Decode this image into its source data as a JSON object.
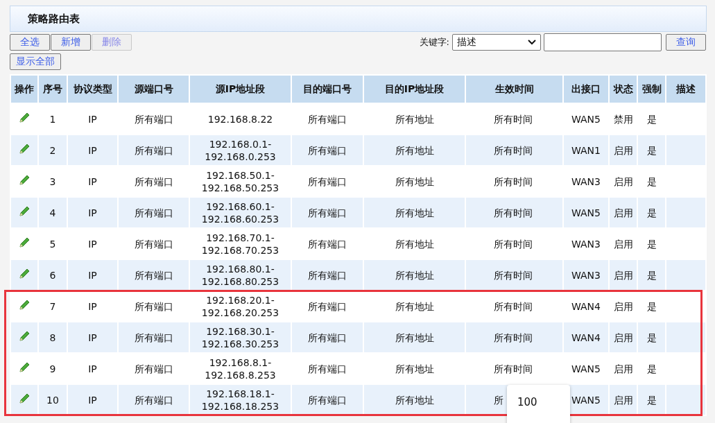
{
  "title": "策略路由表",
  "buttons": [
    {
      "label": "全选",
      "disabled": false
    },
    {
      "label": "新增",
      "disabled": false
    },
    {
      "label": "删除",
      "disabled": true
    }
  ],
  "search": {
    "label": "关键字:",
    "select_value": "描述",
    "button": "查询"
  },
  "show_all": "显示全部",
  "table": {
    "columns": [
      "操作",
      "序号",
      "协议类型",
      "源端口号",
      "源IP地址段",
      "目的端口号",
      "目的IP地址段",
      "生效时间",
      "出接口",
      "状态",
      "强制",
      "描述"
    ],
    "rows": [
      {
        "no": "1",
        "proto": "IP",
        "src_port": "所有端口",
        "src_ip": [
          "192.168.8.22"
        ],
        "dst_port": "所有端口",
        "dst_ip": "所有地址",
        "time": "所有时间",
        "iface": "WAN5",
        "status": "禁用",
        "force": "是",
        "highlighted": false
      },
      {
        "no": "2",
        "proto": "IP",
        "src_port": "所有端口",
        "src_ip": [
          "192.168.0.1-",
          "192.168.0.253"
        ],
        "dst_port": "所有端口",
        "dst_ip": "所有地址",
        "time": "所有时间",
        "iface": "WAN1",
        "status": "启用",
        "force": "是",
        "highlighted": false
      },
      {
        "no": "3",
        "proto": "IP",
        "src_port": "所有端口",
        "src_ip": [
          "192.168.50.1-",
          "192.168.50.253"
        ],
        "dst_port": "所有端口",
        "dst_ip": "所有地址",
        "time": "所有时间",
        "iface": "WAN3",
        "status": "启用",
        "force": "是",
        "highlighted": false
      },
      {
        "no": "4",
        "proto": "IP",
        "src_port": "所有端口",
        "src_ip": [
          "192.168.60.1-",
          "192.168.60.253"
        ],
        "dst_port": "所有端口",
        "dst_ip": "所有地址",
        "time": "所有时间",
        "iface": "WAN5",
        "status": "启用",
        "force": "是",
        "highlighted": false
      },
      {
        "no": "5",
        "proto": "IP",
        "src_port": "所有端口",
        "src_ip": [
          "192.168.70.1-",
          "192.168.70.253"
        ],
        "dst_port": "所有端口",
        "dst_ip": "所有地址",
        "time": "所有时间",
        "iface": "WAN3",
        "status": "启用",
        "force": "是",
        "highlighted": false
      },
      {
        "no": "6",
        "proto": "IP",
        "src_port": "所有端口",
        "src_ip": [
          "192.168.80.1-",
          "192.168.80.253"
        ],
        "dst_port": "所有端口",
        "dst_ip": "所有地址",
        "time": "所有时间",
        "iface": "WAN3",
        "status": "启用",
        "force": "是",
        "highlighted": false
      },
      {
        "no": "7",
        "proto": "IP",
        "src_port": "所有端口",
        "src_ip": [
          "192.168.20.1-",
          "192.168.20.253"
        ],
        "dst_port": "所有端口",
        "dst_ip": "所有地址",
        "time": "所有时间",
        "iface": "WAN4",
        "status": "启用",
        "force": "是",
        "highlighted": true
      },
      {
        "no": "8",
        "proto": "IP",
        "src_port": "所有端口",
        "src_ip": [
          "192.168.30.1-",
          "192.168.30.253"
        ],
        "dst_port": "所有端口",
        "dst_ip": "所有地址",
        "time": "所有时间",
        "iface": "WAN4",
        "status": "启用",
        "force": "是",
        "highlighted": true
      },
      {
        "no": "9",
        "proto": "IP",
        "src_port": "所有端口",
        "src_ip": [
          "192.168.8.1-",
          "192.168.8.253"
        ],
        "dst_port": "所有端口",
        "dst_ip": "所有地址",
        "time": "所有时间",
        "iface": "WAN5",
        "status": "启用",
        "force": "是",
        "highlighted": true
      },
      {
        "no": "10",
        "proto": "IP",
        "src_port": "所有端口",
        "src_ip": [
          "192.168.18.1-",
          "192.168.18.253"
        ],
        "dst_port": "所有端口",
        "dst_ip": "所有地址",
        "time": "所",
        "iface": "WAN5",
        "status": "启用",
        "force": "是",
        "highlighted": true
      }
    ]
  },
  "popup": {
    "text": "100"
  }
}
